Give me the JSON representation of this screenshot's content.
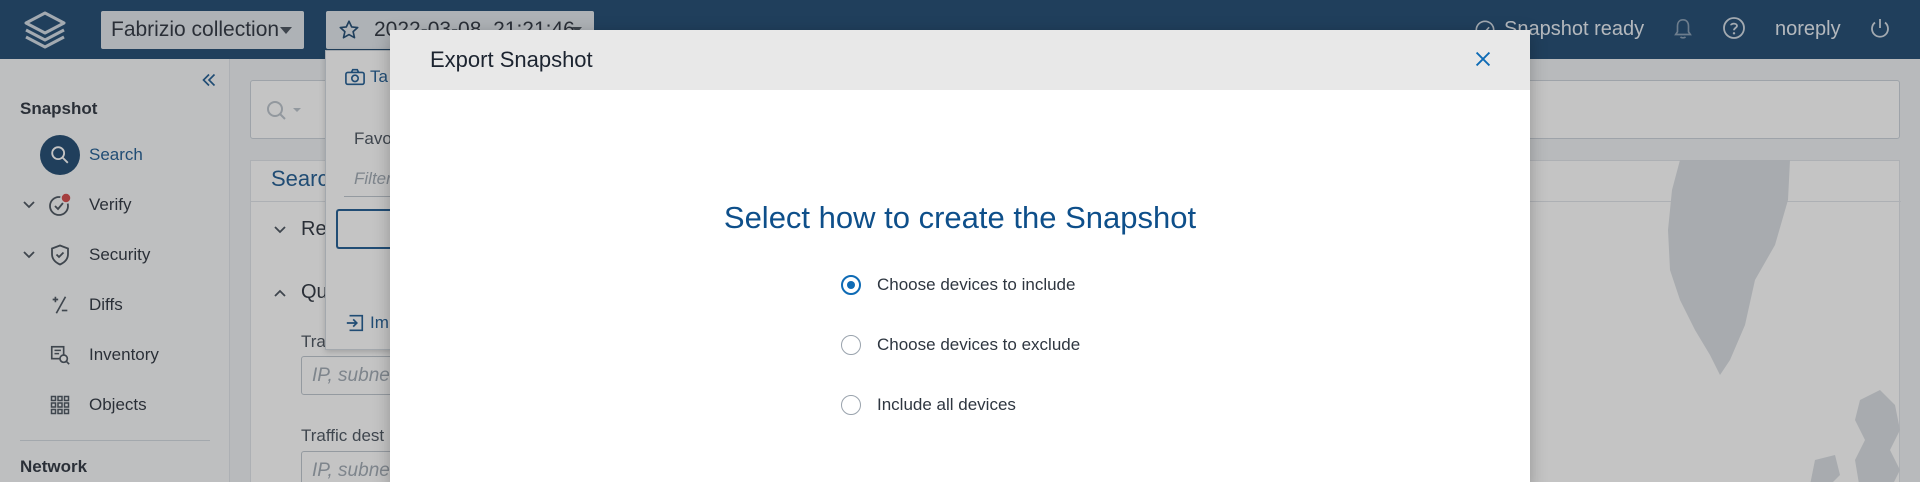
{
  "topbar": {
    "collection": "Fabrizio collection",
    "snapshot": "2022-03-08, 21:21:46",
    "status": "Snapshot ready",
    "user": "noreply"
  },
  "sidebar": {
    "section_snapshot": "Snapshot",
    "items": [
      {
        "label": "Search",
        "icon": "search-icon",
        "active": true
      },
      {
        "label": "Verify",
        "icon": "verify-icon"
      },
      {
        "label": "Security",
        "icon": "shield-icon"
      },
      {
        "label": "Diffs",
        "icon": "diff-icon"
      },
      {
        "label": "Inventory",
        "icon": "inventory-icon"
      },
      {
        "label": "Objects",
        "icon": "objects-icon"
      }
    ],
    "section_network": "Network"
  },
  "main": {
    "panel_title": "Search",
    "accordion_1": "Re",
    "accordion_2": "Qu",
    "field_1_label": "Tra",
    "field_1_placeholder": "IP, subnet",
    "field_2_label": "Traffic dest",
    "field_2_placeholder": "IP, subnet"
  },
  "dropdown": {
    "take": "Ta",
    "favorites": "Favo",
    "filter": "Filter",
    "import": "Im"
  },
  "modal": {
    "title": "Export Snapshot",
    "heading": "Select how to create the Snapshot",
    "options": [
      {
        "label": "Choose devices to include",
        "checked": true
      },
      {
        "label": "Choose devices to exclude",
        "checked": false
      },
      {
        "label": "Include all devices",
        "checked": false
      }
    ]
  },
  "colors": {
    "topbar": "#0e3c66",
    "accent": "#0e4f8a",
    "radio": "#0e6bb5"
  }
}
